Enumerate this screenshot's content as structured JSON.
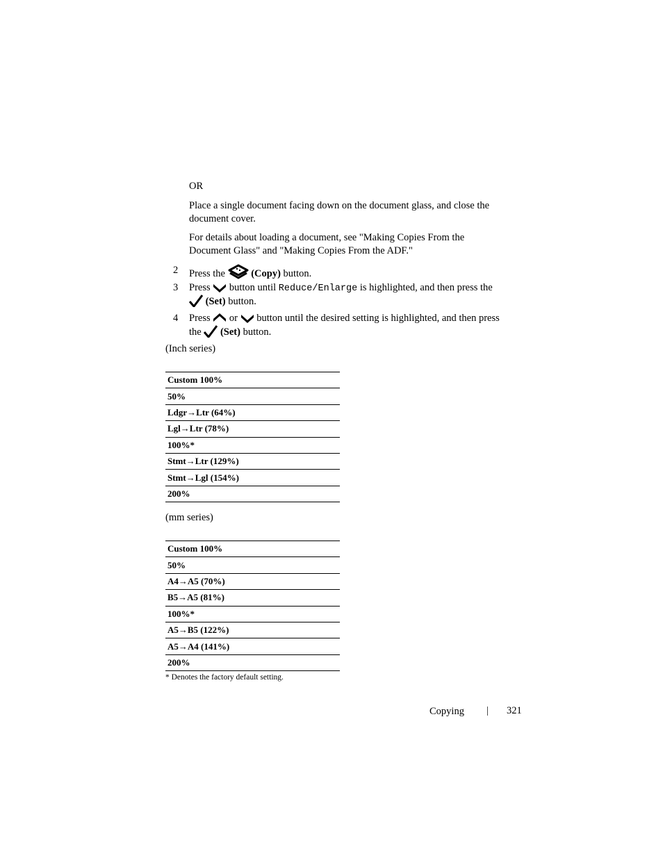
{
  "intro": {
    "or": "OR",
    "para1": "Place a single document facing down on the document glass, and close the document cover.",
    "para2": "For details about loading a document, see \"Making Copies From the Document Glass\" and \"Making Copies From the ADF.\""
  },
  "steps": [
    {
      "num": "2",
      "pre": "Press the",
      "bold": "(Copy)",
      "post": "button.",
      "icon": "copy-icon"
    },
    {
      "num": "3",
      "pre": "Press",
      "mid": "button until",
      "mono": "Reduce/Enlarge",
      "post": "is highlighted, and then press the",
      "bold": "(Set)",
      "end": "button."
    },
    {
      "num": "4",
      "pre": "Press",
      "or": "or",
      "mid": "button until the desired setting is highlighted, and then press",
      "the": "the",
      "bold": "(Set)",
      "end": "button."
    }
  ],
  "inch": {
    "label": "(Inch series)",
    "rows": [
      "Custom 100%",
      "50%",
      "Ldgr→Ltr (64%)",
      "Lgl→Ltr (78%)",
      "100%*",
      "Stmt→Ltr (129%)",
      "Stmt→Lgl (154%)",
      "200%"
    ]
  },
  "mm": {
    "label": "(mm series)",
    "rows": [
      "Custom 100%",
      "50%",
      "A4→A5 (70%)",
      "B5→A5 (81%)",
      "100%*",
      "A5→B5 (122%)",
      "A5→A4 (141%)",
      "200%"
    ]
  },
  "footnote": "* Denotes the factory default setting.",
  "footer": {
    "section": "Copying",
    "separator": "|",
    "page": "321"
  }
}
